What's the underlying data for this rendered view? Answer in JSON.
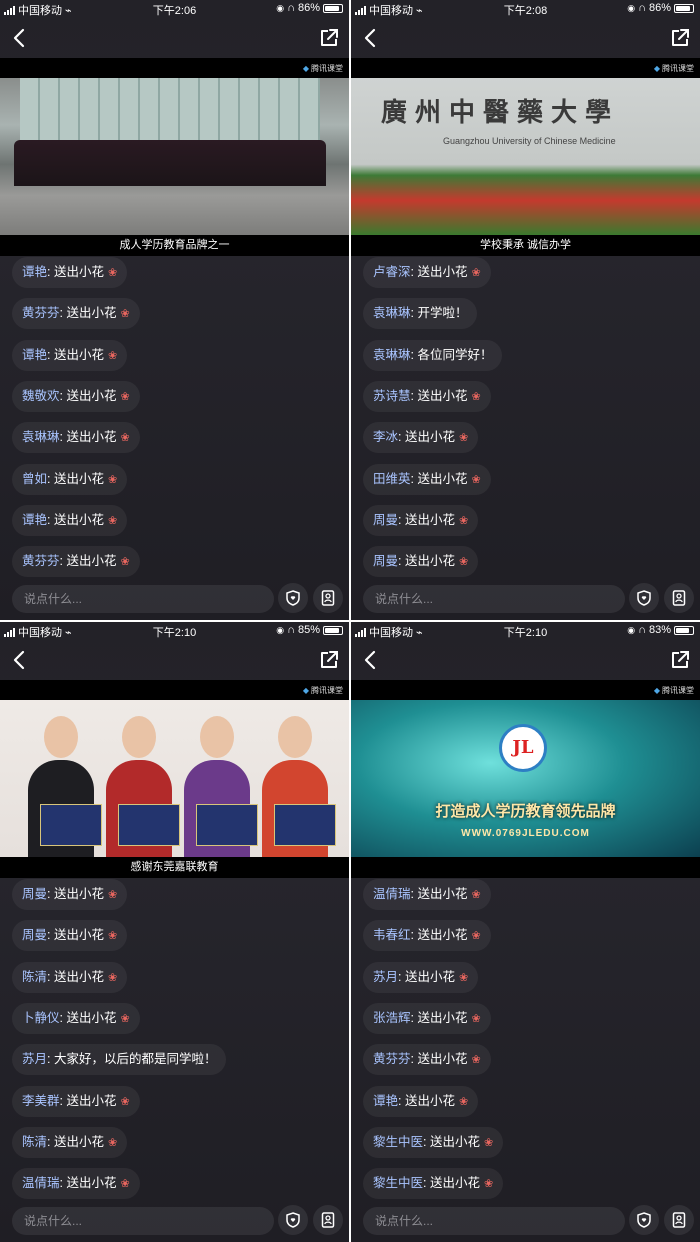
{
  "status_bar": {
    "carrier": "中国移动",
    "panels": [
      {
        "time": "下午2:06",
        "battery": "86%",
        "level": 0.86
      },
      {
        "time": "下午2:08",
        "battery": "86%",
        "level": 0.86
      },
      {
        "time": "下午2:10",
        "battery": "85%",
        "level": 0.85
      },
      {
        "time": "下午2:10",
        "battery": "83%",
        "level": 0.83
      }
    ]
  },
  "video": {
    "brand": "腾讯课堂",
    "captions": [
      "成人学历教育品牌之一",
      "学校秉承 诚信办学",
      "感谢东莞嘉联教育",
      ""
    ],
    "sign_text": "廣州中醫藥大學",
    "sign_sub": "Guangzhou University of Chinese Medicine",
    "logo_text": "JL",
    "slogan": "打造成人学历教育领先品牌",
    "url": "WWW.0769JLEDU.COM"
  },
  "chat": {
    "panels": [
      [
        {
          "name": "谭艳",
          "text": "送出小花",
          "flower": true
        },
        {
          "name": "黄芬芬",
          "text": "送出小花",
          "flower": true
        },
        {
          "name": "谭艳",
          "text": "送出小花",
          "flower": true
        },
        {
          "name": "魏敬欢",
          "text": "送出小花",
          "flower": true
        },
        {
          "name": "袁琳琳",
          "text": "送出小花",
          "flower": true
        },
        {
          "name": "曾如",
          "text": "送出小花",
          "flower": true
        },
        {
          "name": "谭艳",
          "text": "送出小花",
          "flower": true
        },
        {
          "name": "黄芬芬",
          "text": "送出小花",
          "flower": true
        }
      ],
      [
        {
          "name": "卢睿深",
          "text": "送出小花",
          "flower": true
        },
        {
          "name": "袁琳琳",
          "text": "开学啦！",
          "flower": false
        },
        {
          "name": "袁琳琳",
          "text": "各位同学好！",
          "flower": false
        },
        {
          "name": "苏诗慧",
          "text": "送出小花",
          "flower": true
        },
        {
          "name": "李冰",
          "text": "送出小花",
          "flower": true
        },
        {
          "name": "田维英",
          "text": "送出小花",
          "flower": true
        },
        {
          "name": "周曼",
          "text": "送出小花",
          "flower": true
        },
        {
          "name": "周曼",
          "text": "送出小花",
          "flower": true
        }
      ],
      [
        {
          "name": "周曼",
          "text": "送出小花",
          "flower": true
        },
        {
          "name": "周曼",
          "text": "送出小花",
          "flower": true
        },
        {
          "name": "陈清",
          "text": "送出小花",
          "flower": true
        },
        {
          "name": "卜静仪",
          "text": "送出小花",
          "flower": true
        },
        {
          "name": "苏月",
          "text": "大家好，以后的都是同学啦！",
          "flower": false
        },
        {
          "name": "李美群",
          "text": "送出小花",
          "flower": true
        },
        {
          "name": "陈清",
          "text": "送出小花",
          "flower": true
        },
        {
          "name": "温倩瑞",
          "text": "送出小花",
          "flower": true
        }
      ],
      [
        {
          "name": "温倩瑞",
          "text": "送出小花",
          "flower": true
        },
        {
          "name": "韦春红",
          "text": "送出小花",
          "flower": true
        },
        {
          "name": "苏月",
          "text": "送出小花",
          "flower": true
        },
        {
          "name": "张浩辉",
          "text": "送出小花",
          "flower": true
        },
        {
          "name": "黄芬芬",
          "text": "送出小花",
          "flower": true
        },
        {
          "name": "谭艳",
          "text": "送出小花",
          "flower": true
        },
        {
          "name": "黎生中医",
          "text": "送出小花",
          "flower": true
        },
        {
          "name": "黎生中医",
          "text": "送出小花",
          "flower": true
        }
      ]
    ]
  },
  "input": {
    "placeholder": "说点什么..."
  },
  "icons": {
    "back": "chevron-left-icon",
    "share": "share-icon",
    "gift": "shield-heart-icon",
    "profile": "person-badge-icon",
    "flower": "flower-icon"
  },
  "colors": {
    "background": "#232228",
    "name": "#a9c4ff",
    "flower": "#e8665f"
  }
}
